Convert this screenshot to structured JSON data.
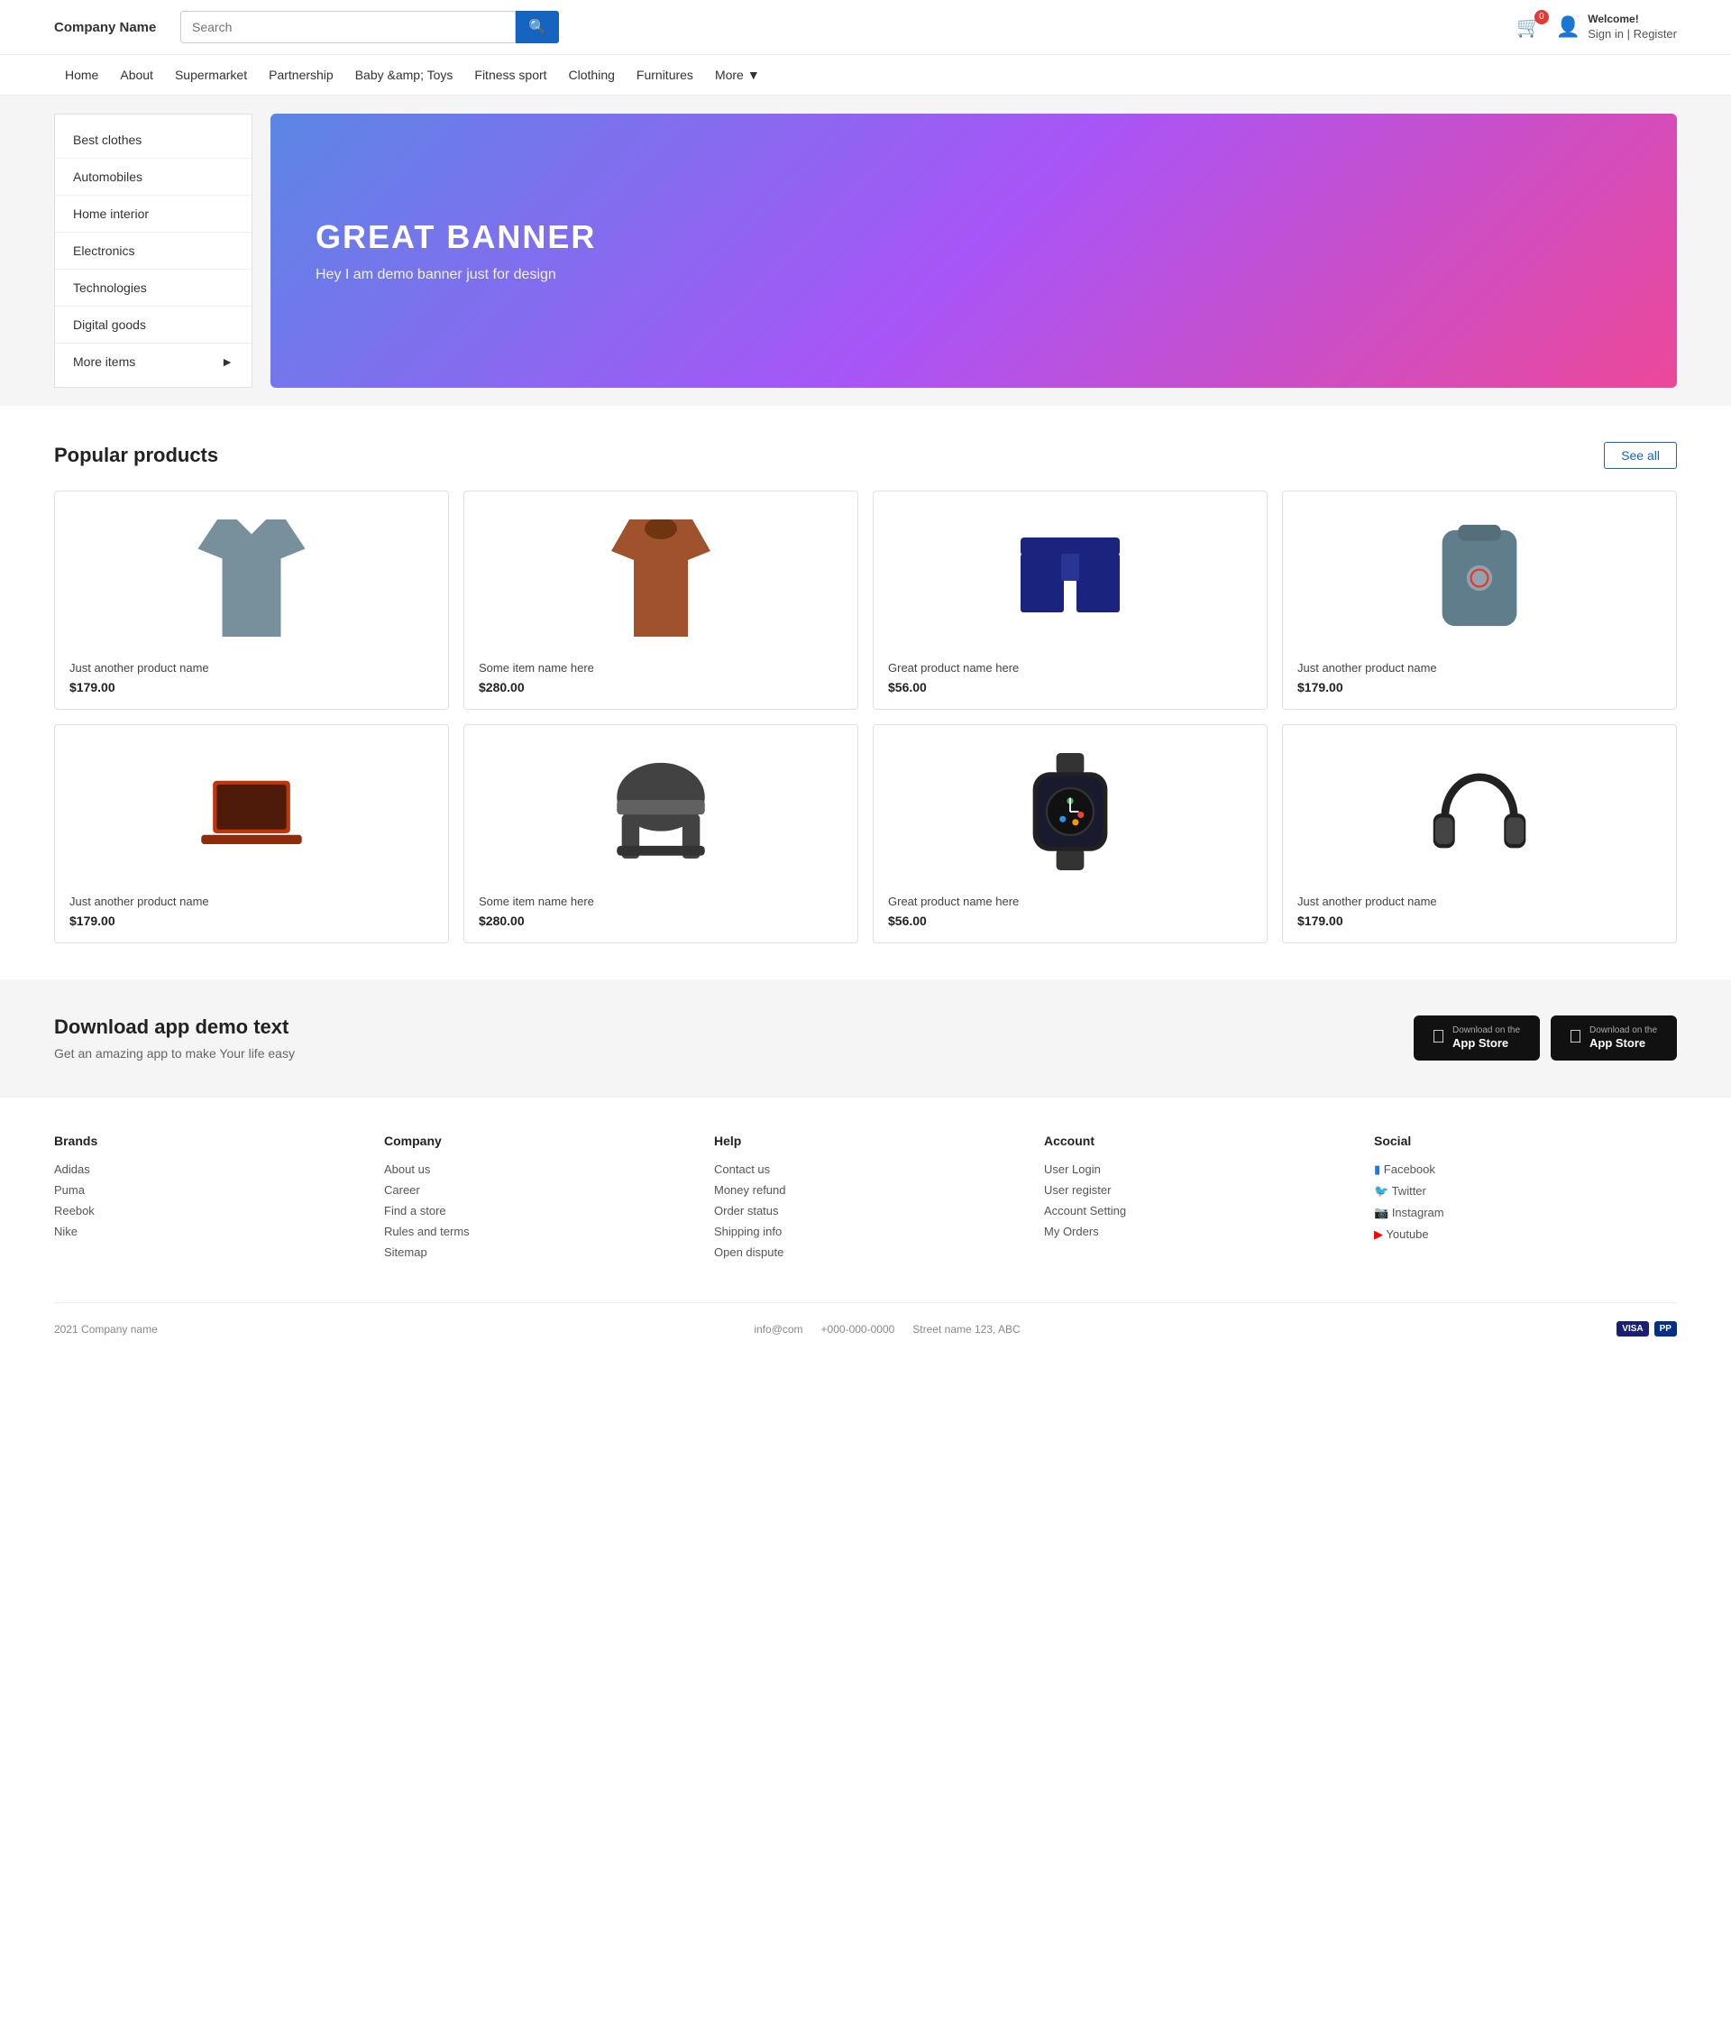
{
  "header": {
    "company_name": "Company Name",
    "search_placeholder": "Search",
    "cart_count": "0",
    "welcome_greeting": "Welcome!",
    "sign_in_register": "Sign in | Register"
  },
  "navbar": {
    "items": [
      {
        "label": "Home",
        "href": "#"
      },
      {
        "label": "About",
        "href": "#"
      },
      {
        "label": "Supermarket",
        "href": "#"
      },
      {
        "label": "Partnership",
        "href": "#"
      },
      {
        "label": "Baby &amp; Toys",
        "href": "#"
      },
      {
        "label": "Fitness sport",
        "href": "#"
      },
      {
        "label": "Clothing",
        "href": "#"
      },
      {
        "label": "Furnitures",
        "href": "#"
      },
      {
        "label": "More",
        "href": "#"
      }
    ]
  },
  "sidebar": {
    "items": [
      {
        "label": "Best clothes"
      },
      {
        "label": "Automobiles"
      },
      {
        "label": "Home interior"
      },
      {
        "label": "Electronics"
      },
      {
        "label": "Technologies"
      },
      {
        "label": "Digital goods"
      },
      {
        "label": "More items"
      }
    ]
  },
  "banner": {
    "title": "GREAT BANNER",
    "subtitle": "Hey I am demo banner just for design"
  },
  "products": {
    "section_title": "Popular products",
    "see_all_label": "See all",
    "items": [
      {
        "name": "Just another product name",
        "price": "$179.00",
        "type": "tshirt"
      },
      {
        "name": "Some item name here",
        "price": "$280.00",
        "type": "jacket"
      },
      {
        "name": "Great product name here",
        "price": "$56.00",
        "type": "shorts"
      },
      {
        "name": "Just another product name",
        "price": "$179.00",
        "type": "backpack"
      },
      {
        "name": "Just another product name",
        "price": "$179.00",
        "type": "laptop"
      },
      {
        "name": "Some item name here",
        "price": "$280.00",
        "type": "chair"
      },
      {
        "name": "Great product name here",
        "price": "$56.00",
        "type": "watch"
      },
      {
        "name": "Just another product name",
        "price": "$179.00",
        "type": "headphones"
      }
    ]
  },
  "app_section": {
    "title": "Download app demo text",
    "subtitle": "Get an amazing app to make Your life easy",
    "btn1_small": "Download on the",
    "btn1_large": "App Store",
    "btn2_small": "Download on the",
    "btn2_large": "App Store"
  },
  "footer": {
    "brands": {
      "heading": "Brands",
      "links": [
        "Adidas",
        "Puma",
        "Reebok",
        "Nike"
      ]
    },
    "company": {
      "heading": "Company",
      "links": [
        "About us",
        "Career",
        "Find a store",
        "Rules and terms",
        "Sitemap"
      ]
    },
    "help": {
      "heading": "Help",
      "links": [
        "Contact us",
        "Money refund",
        "Order status",
        "Shipping info",
        "Open dispute"
      ]
    },
    "account": {
      "heading": "Account",
      "links": [
        "User Login",
        "User register",
        "Account Setting",
        "My Orders"
      ]
    },
    "social": {
      "heading": "Social",
      "links": [
        {
          "label": "Facebook",
          "icon": "facebook"
        },
        {
          "label": "Twitter",
          "icon": "twitter"
        },
        {
          "label": "Instagram",
          "icon": "instagram"
        },
        {
          "label": "Youtube",
          "icon": "youtube"
        }
      ]
    },
    "bottom": {
      "copyright": "2021 Company name",
      "email": "info@com",
      "phone": "+000-000-0000",
      "address": "Street name 123, ABC"
    }
  }
}
